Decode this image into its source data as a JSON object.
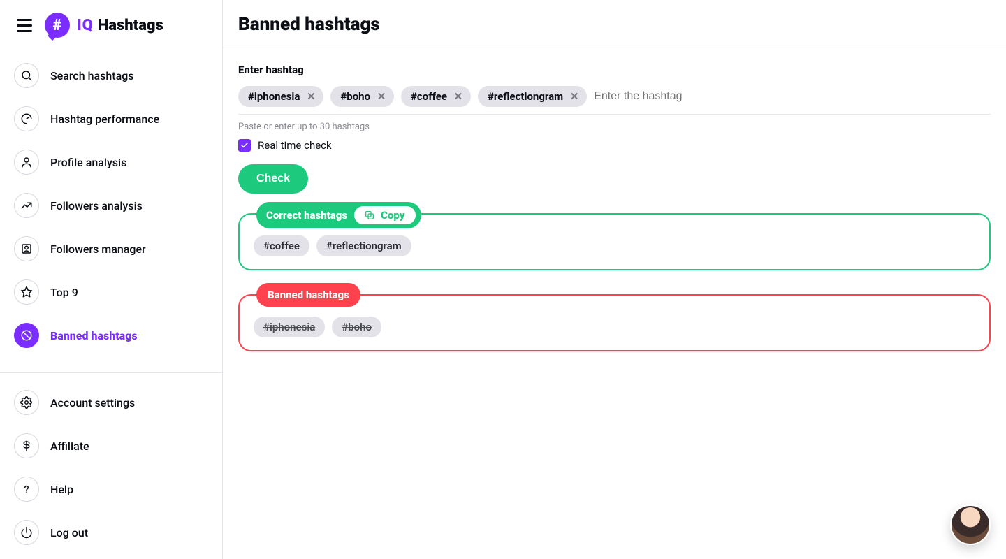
{
  "brand": {
    "iq": "IQ",
    "hashtags": "Hashtags",
    "badge_symbol": "#"
  },
  "sidebar": {
    "items": [
      {
        "label": "Search hashtags"
      },
      {
        "label": "Hashtag performance"
      },
      {
        "label": "Profile analysis"
      },
      {
        "label": "Followers analysis"
      },
      {
        "label": "Followers manager"
      },
      {
        "label": "Top 9"
      },
      {
        "label": "Banned hashtags"
      }
    ],
    "bottom": [
      {
        "label": "Account settings"
      },
      {
        "label": "Affiliate"
      },
      {
        "label": "Help"
      },
      {
        "label": "Log out"
      }
    ]
  },
  "page": {
    "title": "Banned hashtags",
    "input_label": "Enter hashtag",
    "placeholder": "Enter the hashtag",
    "hint": "Paste or enter up to 30 hashtags",
    "realtime_label": "Real time check",
    "realtime_checked": true,
    "check_label": "Check",
    "entered_tags": [
      "#iphonesia",
      "#boho",
      "#coffee",
      "#reflectiongram"
    ],
    "correct_title": "Correct hashtags",
    "copy_label": "Copy",
    "correct_tags": [
      "#coffee",
      "#reflectiongram"
    ],
    "banned_title": "Banned hashtags",
    "banned_tags": [
      "#iphonesia",
      "#boho"
    ]
  },
  "colors": {
    "accent": "#7B2CFF",
    "success": "#1DC97D",
    "danger": "#FF424D"
  }
}
